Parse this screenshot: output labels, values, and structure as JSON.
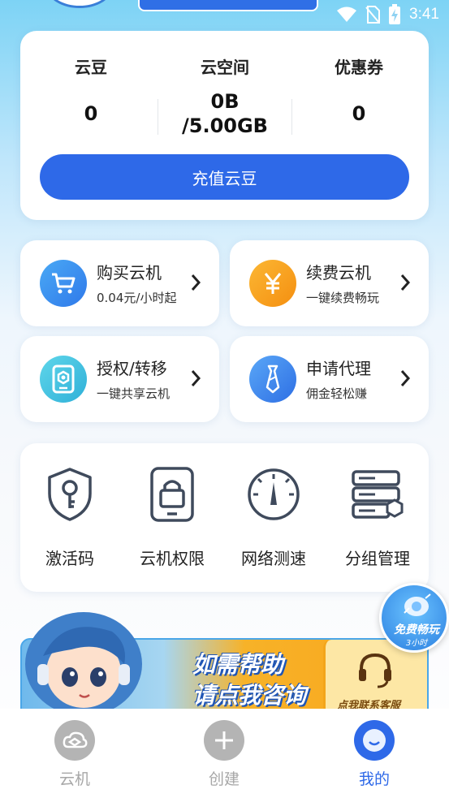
{
  "status_bar": {
    "time": "3:41"
  },
  "assets": {
    "items": [
      {
        "label": "云豆",
        "value": "0"
      },
      {
        "label": "云空间",
        "value_line1": "0B",
        "value_line2": "/5.00GB"
      },
      {
        "label": "优惠券",
        "value": "0"
      }
    ],
    "recharge_label": "充值云豆"
  },
  "actions": [
    {
      "title": "购买云机",
      "subtitle": "0.04元/小时起",
      "icon": "cart-icon",
      "color": "#3c92f0"
    },
    {
      "title": "续费云机",
      "subtitle": "一键续费畅玩",
      "icon": "yuan-icon",
      "color": "#f7a21b"
    },
    {
      "title": "授权/转移",
      "subtitle": "一键共享云机",
      "icon": "share-device-icon",
      "color": "#3cc3e0"
    },
    {
      "title": "申请代理",
      "subtitle": "佣金轻松赚",
      "icon": "tie-icon",
      "color": "#3a86f0"
    }
  ],
  "tools": [
    {
      "label": "激活码",
      "icon": "key-shield-icon"
    },
    {
      "label": "云机权限",
      "icon": "lock-phone-icon"
    },
    {
      "label": "网络测速",
      "icon": "speedometer-icon"
    },
    {
      "label": "分组管理",
      "icon": "server-group-icon"
    }
  ],
  "banner": {
    "headline_line1": "如需帮助",
    "headline_line2": "请点我咨询",
    "service_label": "点我联系客服"
  },
  "promo_badge": {
    "title": "免费畅玩",
    "subtitle": "3小时"
  },
  "tabbar": [
    {
      "label": "云机",
      "icon": "cloud-phone-icon",
      "active": false
    },
    {
      "label": "创建",
      "icon": "plus-icon",
      "active": false
    },
    {
      "label": "我的",
      "icon": "profile-icon",
      "active": true
    }
  ]
}
